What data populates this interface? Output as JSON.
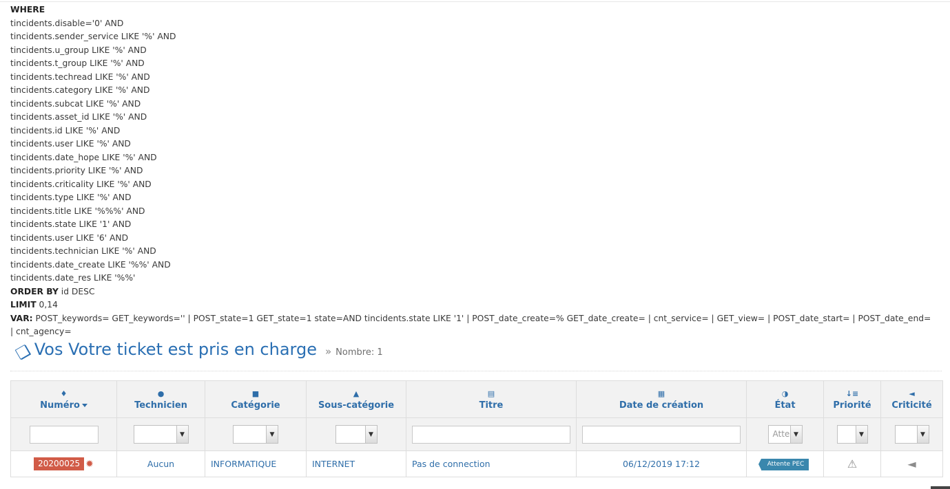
{
  "sql": {
    "where_kw": "WHERE",
    "conditions": [
      "tincidents.disable='0' AND",
      "tincidents.sender_service LIKE '%' AND",
      "tincidents.u_group LIKE '%' AND",
      "tincidents.t_group LIKE '%' AND",
      "tincidents.techread LIKE '%' AND",
      "tincidents.category LIKE '%' AND",
      "tincidents.subcat LIKE '%' AND",
      "tincidents.asset_id LIKE '%' AND",
      "tincidents.id LIKE '%' AND",
      "tincidents.user LIKE '%' AND",
      "tincidents.date_hope LIKE '%' AND",
      "tincidents.priority LIKE '%' AND",
      "tincidents.criticality LIKE '%' AND",
      "tincidents.type LIKE '%' AND",
      "tincidents.title LIKE '%%%' AND",
      "tincidents.state LIKE '1' AND",
      "tincidents.user LIKE '6' AND",
      "tincidents.technician LIKE '%' AND",
      "tincidents.date_create LIKE '%%' AND",
      "tincidents.date_res LIKE '%%'"
    ],
    "order_kw": "ORDER BY",
    "order_val": " id DESC",
    "limit_kw": "LIMIT",
    "limit_val": " 0,14",
    "var_kw": "VAR:",
    "var_val": " POST_keywords= GET_keywords='' | POST_state=1 GET_state=1 state=AND tincidents.state LIKE '1' | POST_date_create=% GET_date_create= | cnt_service= | GET_view= | POST_date_start= | POST_date_end= | cnt_agency="
  },
  "page": {
    "title": "Vos Votre ticket est pris en charge",
    "count_label": "Nombre: 1"
  },
  "table": {
    "columns": [
      {
        "label": "Numéro",
        "icon": "tag-icon"
      },
      {
        "label": "Technicien",
        "icon": "user-icon"
      },
      {
        "label": "Catégorie",
        "icon": "square-icon"
      },
      {
        "label": "Sous-catégorie",
        "icon": "sitemap-icon"
      },
      {
        "label": "Titre",
        "icon": "file-text-icon"
      },
      {
        "label": "Date de création",
        "icon": "calendar-icon"
      },
      {
        "label": "État",
        "icon": "adjust-icon"
      },
      {
        "label": "Priorité",
        "icon": "sort-amount-icon"
      },
      {
        "label": "Criticité",
        "icon": "bullhorn-icon"
      }
    ],
    "filters": {
      "state_value": "Atte"
    },
    "rows": [
      {
        "id": "20200025",
        "technician": "Aucun",
        "category": "INFORMATIQUE",
        "subcategory": "INTERNET",
        "title": "Pas de connection",
        "date_create": "06/12/2019 17:12",
        "state": "Attente PEC",
        "priority_icon": "warning-icon",
        "criticality_icon": "bullhorn-icon"
      }
    ]
  },
  "colors": {
    "accent": "#2f6ea9",
    "badge_red": "#d15b47",
    "state_blue": "#3a87ad"
  }
}
